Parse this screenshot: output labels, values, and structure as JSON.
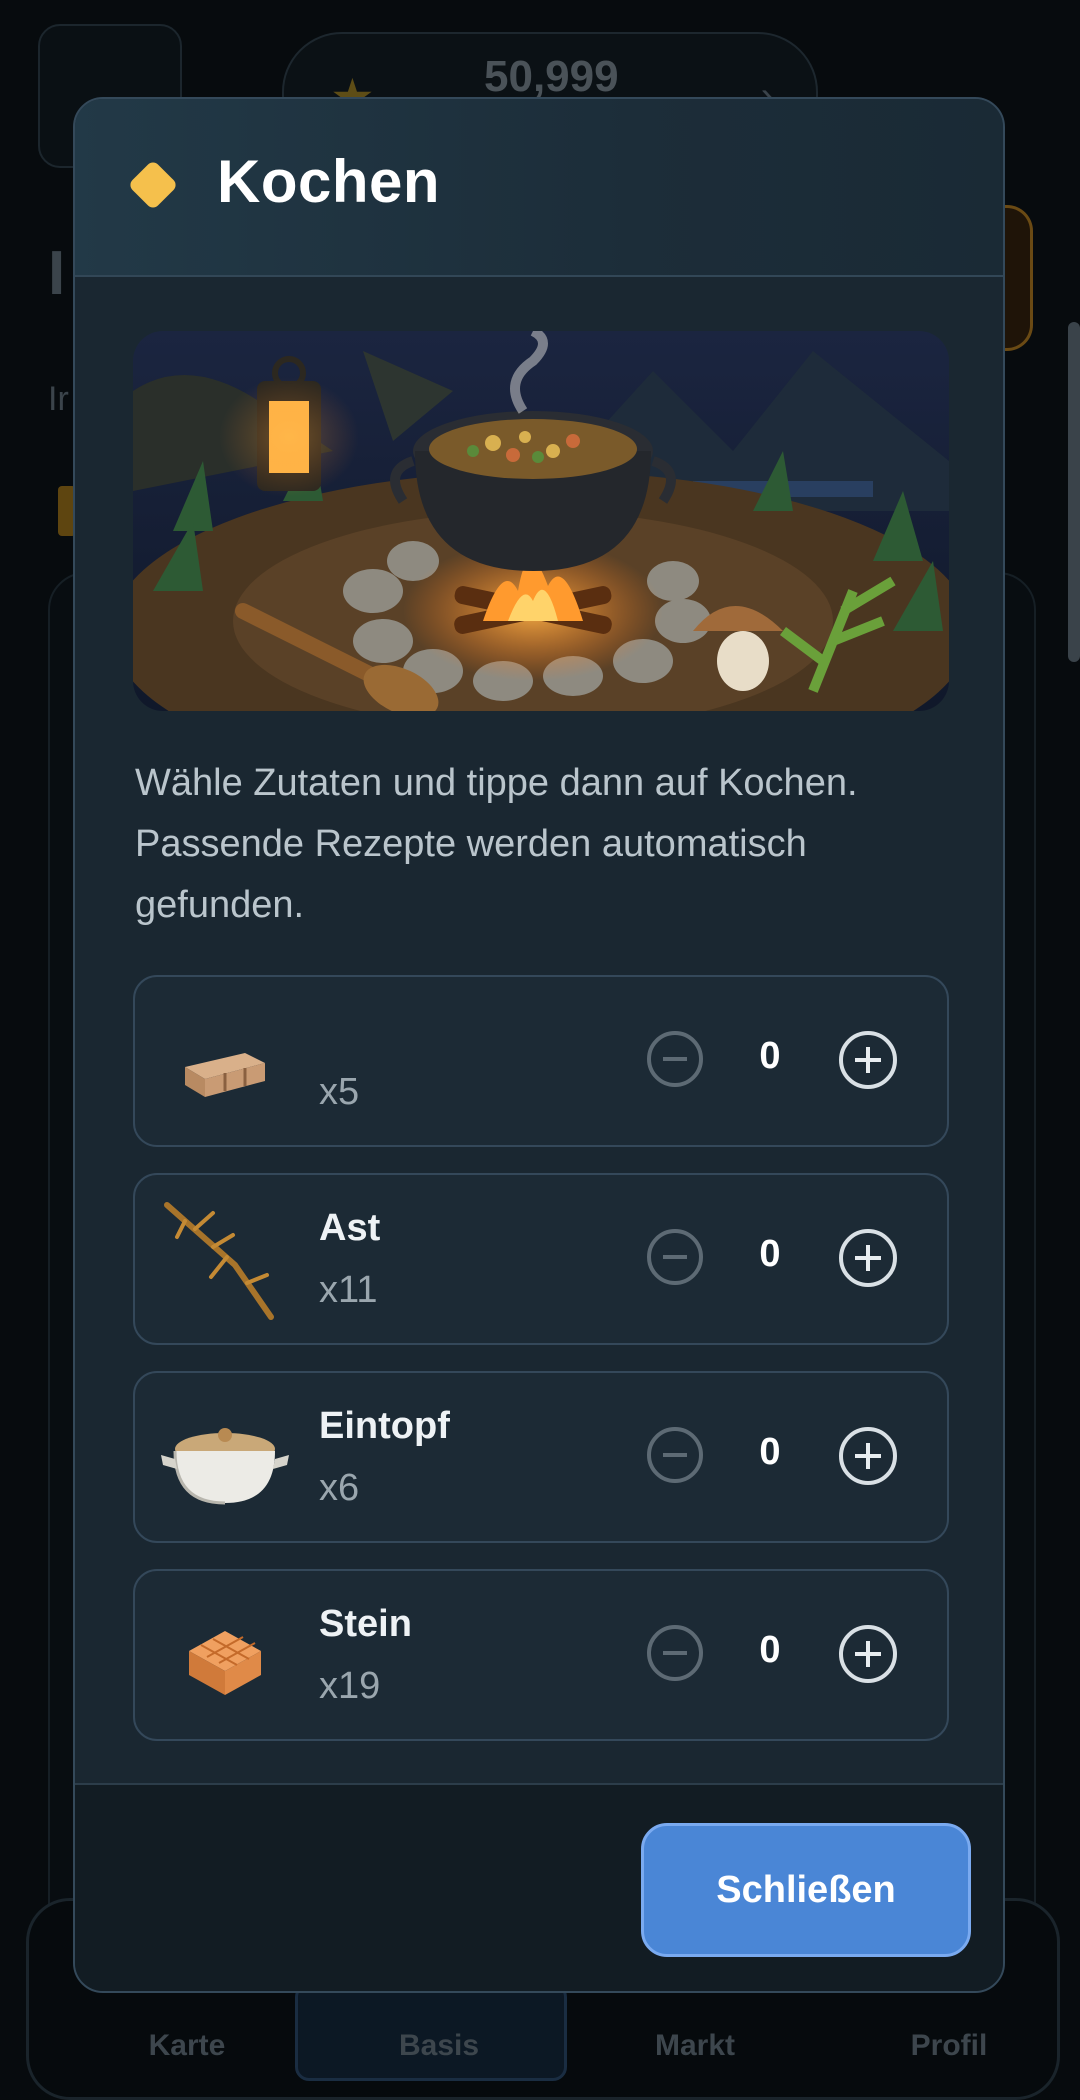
{
  "background": {
    "coins": "50,999",
    "nav": [
      "Karte",
      "Basis",
      "Markt",
      "Profil"
    ]
  },
  "modal": {
    "title": "Kochen",
    "description": "Wähle Zutaten und tippe dann auf Kochen. Passende Rezepte werden automatisch gefunden.",
    "hero_image": "cooking-campfire-pot",
    "ingredients": [
      {
        "name": "",
        "qty": "x5",
        "count": "0",
        "icon": "planks-icon"
      },
      {
        "name": "Ast",
        "qty": "x11",
        "count": "0",
        "icon": "branch-icon"
      },
      {
        "name": "Eintopf",
        "qty": "x6",
        "count": "0",
        "icon": "pot-icon"
      },
      {
        "name": "Stein",
        "qty": "x19",
        "count": "0",
        "icon": "stone-icon"
      }
    ],
    "close_label": "Schließen"
  },
  "colors": {
    "accent": "#4a86d6",
    "diamond": "#f5c04c",
    "modal_bg": "#1a2731"
  }
}
